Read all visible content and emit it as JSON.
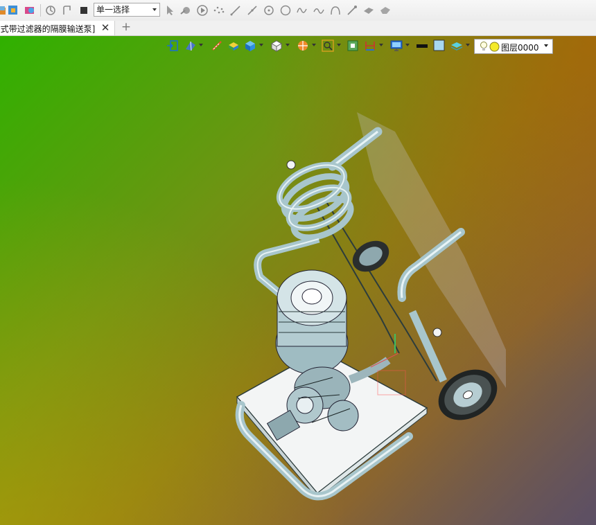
{
  "toolbar": {
    "selection_mode": {
      "value": "单一选择"
    },
    "icons": [
      "part-icon",
      "assembly-icon",
      "model-icon",
      "rotate-icon",
      "path-icon",
      "stop-icon",
      "pointer-icon",
      "snap-icon",
      "play-icon",
      "point-cloud-icon",
      "line-icon",
      "pen-line-icon",
      "circle-center-icon",
      "circle-icon",
      "wave-icon",
      "spline-icon",
      "arc-icon",
      "brush-icon",
      "surface-icon",
      "shape-icon"
    ]
  },
  "tabs": {
    "document": {
      "label": "[式带过滤器的隔膜输送泵]"
    },
    "close_glyph": "✕",
    "add_glyph": "+"
  },
  "view_toolbar": {
    "icons": [
      "exit-view-icon",
      "view-orient-icon",
      "measure-icon",
      "solid-icon",
      "cube-shade-icon",
      "cube-icon",
      "section-icon",
      "zoom-icon",
      "fit-icon",
      "dimension-icon",
      "display-icon",
      "black-color-icon",
      "light-blue-color-icon",
      "layer-icon"
    ],
    "layer": {
      "value": "图层0000"
    }
  },
  "colors": {
    "viewport_top_left": "#2fb100",
    "viewport_top_right": "#9d6f1b",
    "viewport_bottom_right": "#5a5570",
    "model_steel": "#b9d3d8",
    "model_plate": "#f2f4f4"
  }
}
